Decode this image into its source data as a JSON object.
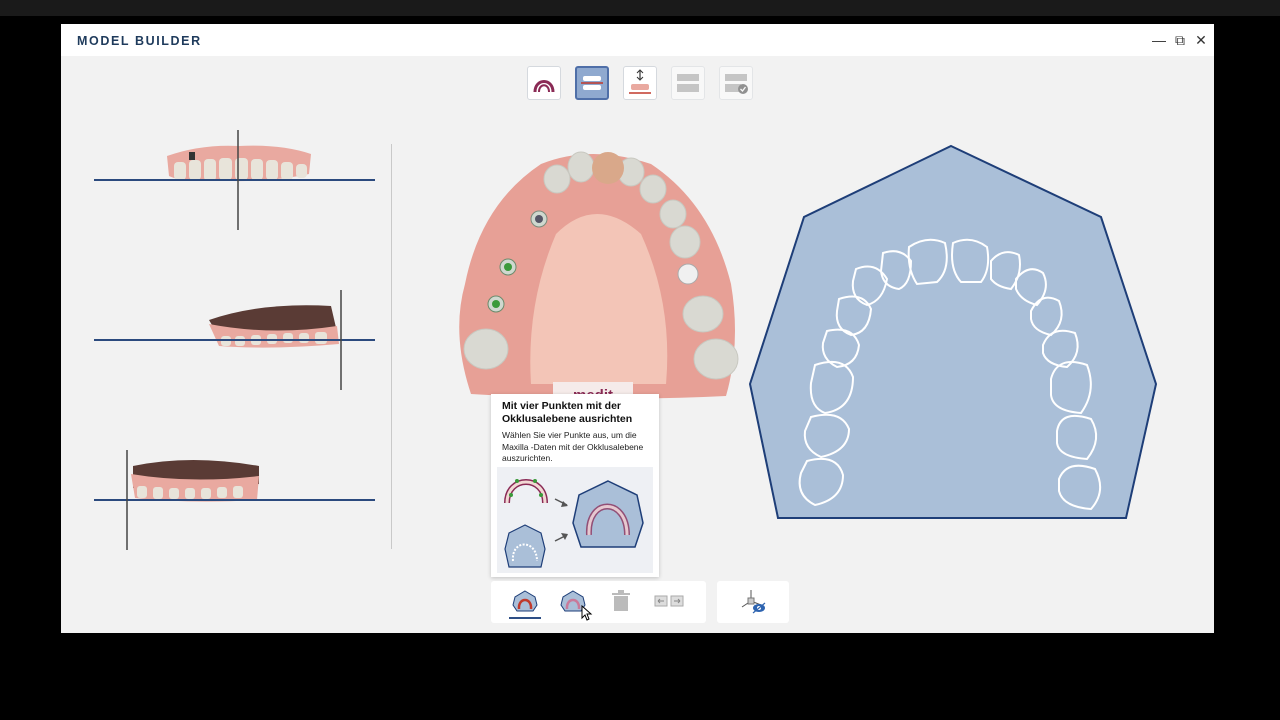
{
  "window": {
    "title": "MODEL  BUILDER",
    "controls": {
      "minimize": "—",
      "restore": "⧉",
      "close": "✕"
    }
  },
  "toolbar": {
    "buttons": [
      {
        "icon": "arch-icon",
        "state": "normal"
      },
      {
        "icon": "occlusion-align-icon",
        "state": "active"
      },
      {
        "icon": "vertical-move-icon",
        "state": "normal"
      },
      {
        "icon": "base-model-icon",
        "state": "disabled"
      },
      {
        "icon": "model-confirm-icon",
        "state": "disabled"
      }
    ]
  },
  "main_view": {
    "logo_text": "medit"
  },
  "tooltip": {
    "title": "Mit vier Punkten mit der Okklusalebene ausrichten",
    "body": "Wählen Sie vier Punkte aus, um die Maxilla -Daten mit der Okklusalebene auszurichten."
  },
  "bottom_bar": {
    "tools": [
      {
        "icon": "maxilla-arch-icon",
        "selected": true
      },
      {
        "icon": "mandible-arch-icon",
        "selected": false
      },
      {
        "icon": "trash-icon",
        "selected": false
      },
      {
        "icon": "swap-arrows-icon",
        "selected": false
      }
    ],
    "view_tool": {
      "icon": "axis-visibility-icon"
    }
  },
  "colors": {
    "accent": "#4f6fa8",
    "arch_fill": "#aabfd8",
    "arch_stroke": "#1e3e78",
    "plane_line": "#2b4a7e",
    "gum": "#e9a9a0",
    "tooth": "#eae6dc"
  }
}
